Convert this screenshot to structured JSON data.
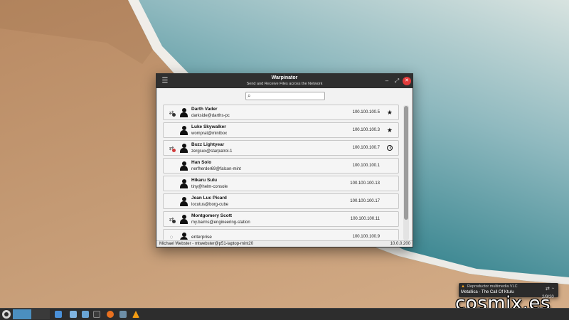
{
  "window": {
    "title": "Warpinator",
    "subtitle": "Send and Receive Files across the Network",
    "menu_icon": "hamburger-icon",
    "controls": {
      "minimize": "–",
      "maximize": "⤢",
      "close": "✕"
    }
  },
  "search": {
    "placeholder": "",
    "value": ""
  },
  "devices": [
    {
      "name": "Darth Vader",
      "user": "darkside@darths-pc",
      "ip": "100.100.100.5",
      "status_icon": "transfer-icon",
      "status_color": "#333333",
      "favorite": true,
      "pending": false
    },
    {
      "name": "Luke Skywalker",
      "user": "womprat@mintbox",
      "ip": "100.100.100.3",
      "status_icon": "none",
      "status_color": "",
      "favorite": true,
      "pending": false
    },
    {
      "name": "Buzz Lightyear",
      "user": "zergsux@starpatrol-1",
      "ip": "100.100.100.7",
      "status_icon": "transfer-blocked-icon",
      "status_color": "#d13a3a",
      "favorite": false,
      "pending": true
    },
    {
      "name": "Han Solo",
      "user": "nerfherder69@falcon-mint",
      "ip": "100.100.100.1",
      "status_icon": "none",
      "status_color": "",
      "favorite": false,
      "pending": false
    },
    {
      "name": "Hikaru Sulu",
      "user": "tiny@helm-console",
      "ip": "100.100.100.13",
      "status_icon": "none",
      "status_color": "",
      "favorite": false,
      "pending": false
    },
    {
      "name": "Jean Luc Picard",
      "user": "locutus@borg-cube",
      "ip": "100.100.100.17",
      "status_icon": "none",
      "status_color": "",
      "favorite": false,
      "pending": false
    },
    {
      "name": "Montgomery Scott",
      "user": "my.bairns@engineering-station",
      "ip": "100.100.100.11",
      "status_icon": "transfer-icon",
      "status_color": "#333333",
      "favorite": false,
      "pending": false
    },
    {
      "name": "enterprise",
      "user": "",
      "ip": "100.100.100.9",
      "status_icon": "spinner-icon",
      "status_color": "#333333",
      "favorite": false,
      "pending": false
    }
  ],
  "statusbar": {
    "left": "Michael Webster - mtwebster@p51-laptop-mint20",
    "right": "10.0.0.200"
  },
  "notification": {
    "title": "Reproductor multimedia VLC",
    "body": "Metallica - The Call Of Ktulu"
  },
  "watermark": "cosmix.es",
  "clock_date": "2/9/20",
  "colors": {
    "accent": "#4b8fc0",
    "titlebar": "#2f2f2f",
    "close": "#e23b3b"
  }
}
